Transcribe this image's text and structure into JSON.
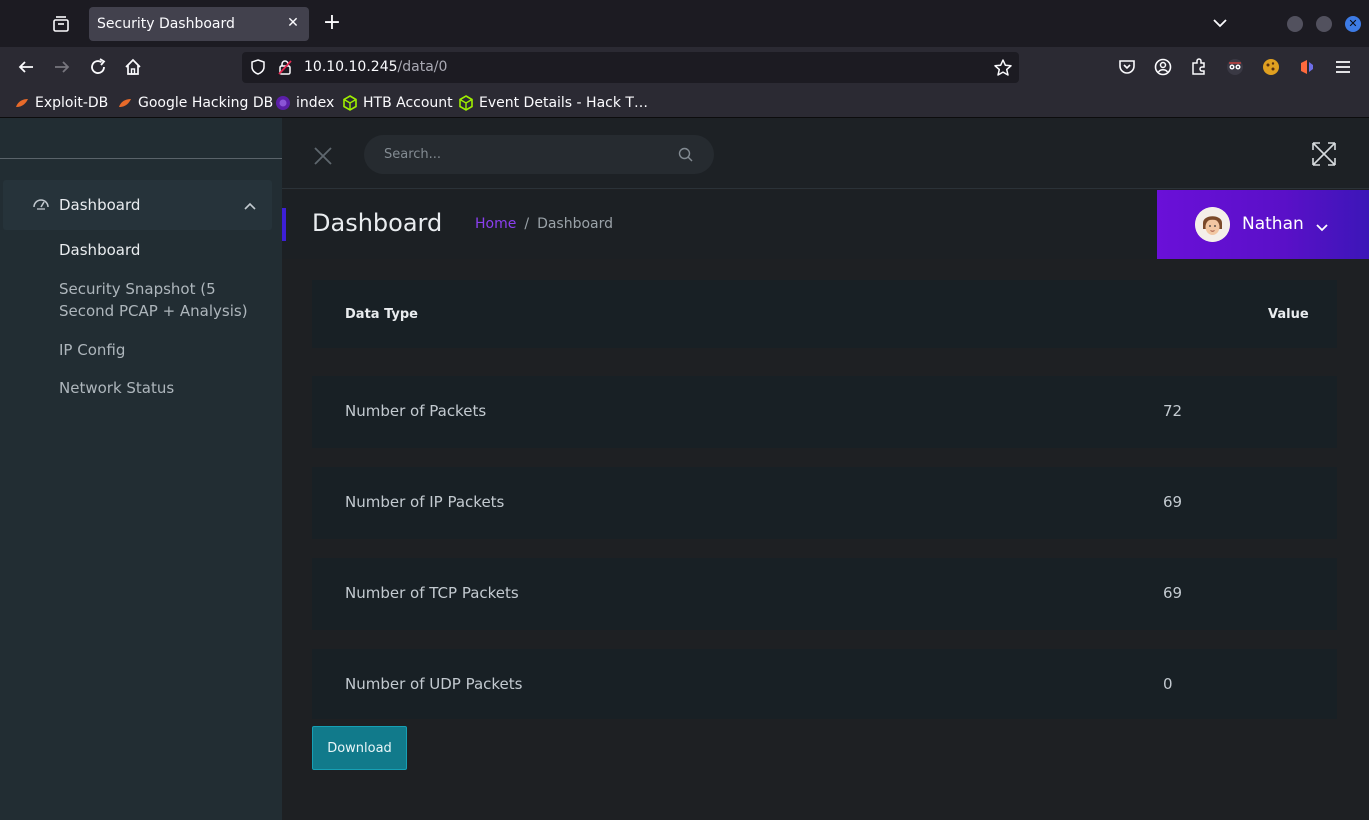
{
  "browser": {
    "tab_title": "Security Dashboard",
    "url_host": "10.10.10.245",
    "url_path": "/data/0",
    "bookmarks": [
      {
        "label": "Exploit-DB",
        "icon": "exploit-db-icon"
      },
      {
        "label": "Google Hacking DB",
        "icon": "ghdb-icon"
      },
      {
        "label": "index",
        "icon": "index-icon"
      },
      {
        "label": "HTB Account",
        "icon": "htb-icon"
      },
      {
        "label": "Event Details - Hack T…",
        "icon": "htb-icon"
      }
    ]
  },
  "sidebar": {
    "parent_label": "Dashboard",
    "items": [
      {
        "label": "Dashboard"
      },
      {
        "label": "Security Snapshot (5 Second PCAP + Analysis)"
      },
      {
        "label": "IP Config"
      },
      {
        "label": "Network Status"
      }
    ]
  },
  "search": {
    "placeholder": "Search..."
  },
  "header": {
    "title": "Dashboard",
    "breadcrumb_home": "Home",
    "breadcrumb_sep": "/",
    "breadcrumb_current": "Dashboard"
  },
  "user": {
    "name": "Nathan"
  },
  "table": {
    "headers": {
      "type": "Data Type",
      "value": "Value"
    },
    "rows": [
      {
        "label": "Number of Packets",
        "value": "72"
      },
      {
        "label": "Number of IP Packets",
        "value": "69"
      },
      {
        "label": "Number of TCP Packets",
        "value": "69"
      },
      {
        "label": "Number of UDP Packets",
        "value": "0"
      }
    ]
  },
  "download_label": "Download",
  "colors": {
    "accent": "#6a10d8",
    "button": "#117a8b"
  }
}
